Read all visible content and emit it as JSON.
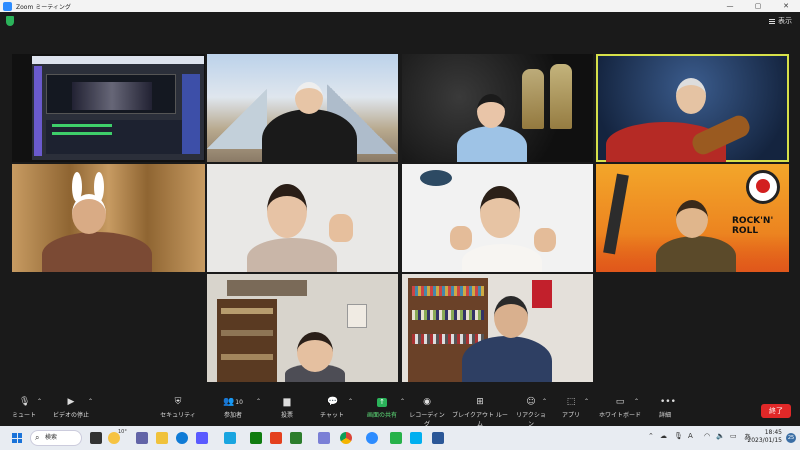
{
  "window": {
    "title": "Zoom ミーティング",
    "minimize": "—",
    "maximize": "▢",
    "close": "✕"
  },
  "top": {
    "view_label": "表示"
  },
  "participants": [
    {
      "id": "screen-share-desktop",
      "kind": "screen"
    },
    {
      "id": "man-louvre-background",
      "kind": "person"
    },
    {
      "id": "woman-champagne-background",
      "kind": "person"
    },
    {
      "id": "man-guitar-snow-background",
      "kind": "person",
      "active_speaker": true
    },
    {
      "id": "man-bunny-ears",
      "kind": "person"
    },
    {
      "id": "woman-waving-white-room",
      "kind": "person"
    },
    {
      "id": "woman-waving-blank-background",
      "kind": "person"
    },
    {
      "id": "man-rock-n-roll-background",
      "kind": "person",
      "banner": "ROCK'N' ROLL"
    },
    {
      "id": "woman-bookshelf-room",
      "kind": "person"
    },
    {
      "id": "man-bookshelf-room",
      "kind": "person"
    }
  ],
  "toolbar": {
    "mute": "ミュート",
    "video": "ビデオの停止",
    "security": "セキュリティ",
    "participants": "参加者",
    "participants_count": "10",
    "polls": "投票",
    "chat": "チャット",
    "share": "画面の共有",
    "record": "レコーディング",
    "breakout": "ブレイクアウト ルーム",
    "reactions": "リアクション",
    "apps": "アプリ",
    "whiteboard": "ホワイトボード",
    "more": "詳細",
    "end": "終了"
  },
  "taskbar": {
    "search_label": "検索",
    "weather_temp": "10°",
    "tray_ime": "A",
    "tray_lang": "あ",
    "time": "18:45",
    "date": "2023/01/15",
    "notification_count": "25"
  },
  "colors": {
    "accent_green": "#2bb35a",
    "end_red": "#e02828",
    "active_border": "#d6e04a",
    "zoom_blue": "#2d8cff"
  }
}
